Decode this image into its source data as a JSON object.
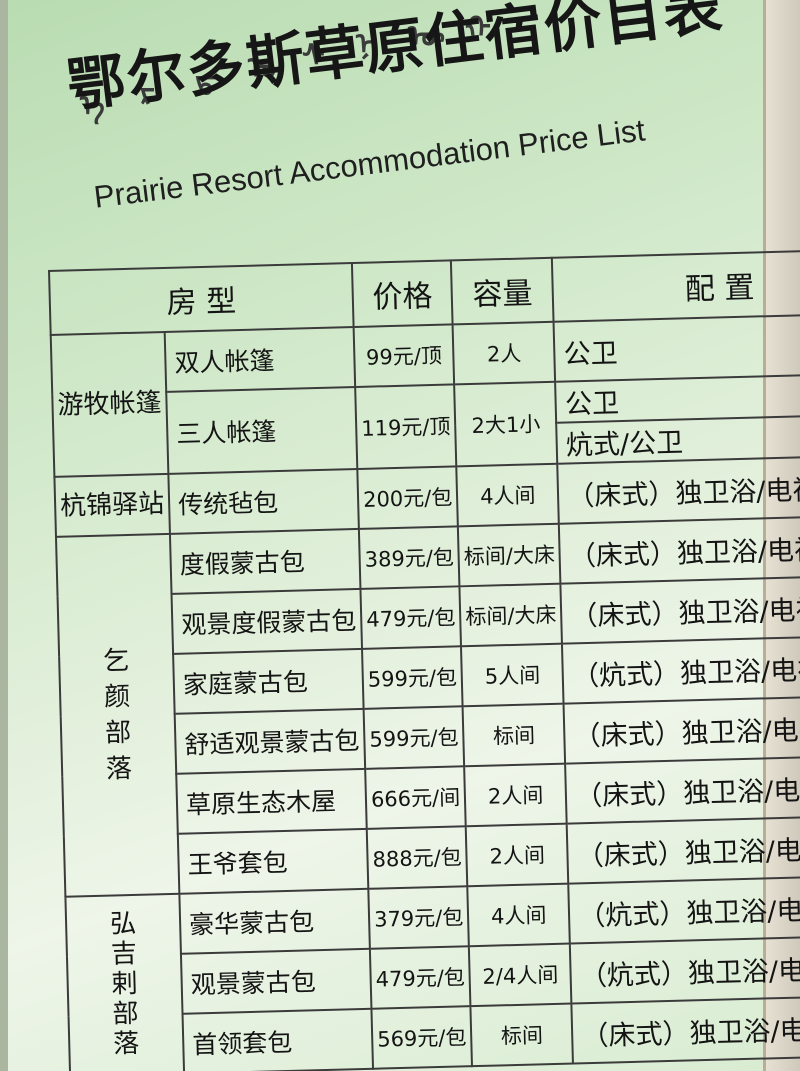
{
  "header": {
    "mongolian_glyphs": [
      "ᠡ",
      "ᠷ",
      "ᠳ",
      "ᠣ",
      "ᠰ",
      "ᠨ",
      "ᠦ",
      "ᠬ"
    ],
    "title_cn": "鄂尔多斯草原住宿价目表",
    "title_en": "Prairie Resort Accommodation Price List"
  },
  "table": {
    "headers": {
      "room_type": "房  型",
      "price": "价格",
      "capacity": "容量",
      "config": "配   置"
    },
    "rows": [
      {
        "group": "游牧帐篷",
        "name": "双人帐篷",
        "price": "99元/顶",
        "capacity": "2人",
        "config": "公卫"
      },
      {
        "group": "",
        "name": "三人帐篷",
        "price": "119元/顶",
        "capacity": "2大1小",
        "config": "公卫"
      },
      {
        "group": "",
        "name": "",
        "price": "",
        "capacity": "",
        "config": "炕式/公卫"
      },
      {
        "group": "杭锦驿站",
        "name": "传统毡包",
        "price": "200元/包",
        "capacity": "4人间",
        "config": "（床式）独卫浴/电视/空调"
      },
      {
        "group": "乞颜部落",
        "name": "度假蒙古包",
        "price": "389元/包",
        "capacity": "标间/大床",
        "config": "（床式）独卫浴/电视/空调"
      },
      {
        "group": "",
        "name": "观景度假蒙古包",
        "price": "479元/包",
        "capacity": "标间/大床",
        "config": "（床式）独卫浴/电视/空调"
      },
      {
        "group": "",
        "name": "家庭蒙古包",
        "price": "599元/包",
        "capacity": "5人间",
        "config": "（炕式）独卫浴/电视/空调"
      },
      {
        "group": "",
        "name": "舒适观景蒙古包",
        "price": "599元/包",
        "capacity": "标间",
        "config": "（床式）独卫浴/电视/空调"
      },
      {
        "group": "",
        "name": "草原生态木屋",
        "price": "666元/间",
        "capacity": "2人间",
        "config": "（床式）独卫浴/电视/空调"
      },
      {
        "group": "",
        "name": "王爷套包",
        "price": "888元/包",
        "capacity": "2人间",
        "config": "（床式）独卫浴/电视/空调"
      },
      {
        "group": "弘吉剌部落",
        "name": "豪华蒙古包",
        "price": "379元/包",
        "capacity": "4人间",
        "config": "（炕式）独卫浴/电视/热水"
      },
      {
        "group": "",
        "name": "观景蒙古包",
        "price": "479元/包",
        "capacity": "2/4人间",
        "config": "（炕式）独卫浴/电视/热水"
      },
      {
        "group": "",
        "name": "首领套包",
        "price": "569元/包",
        "capacity": "标间",
        "config": "（床式）独卫浴/电视/客厅"
      }
    ]
  }
}
